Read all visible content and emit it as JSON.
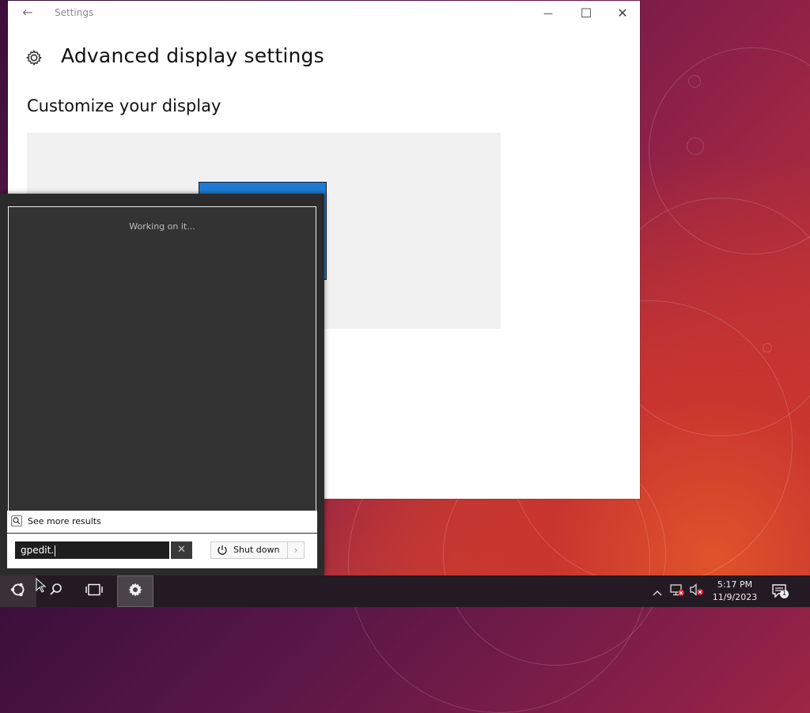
{
  "settings_window": {
    "app_title": "Settings",
    "page_title": "Advanced display settings",
    "section_title": "Customize your display",
    "minimize_glyph": "—",
    "maximize_glyph": "☐",
    "close_glyph": "✕"
  },
  "start_menu": {
    "status_text": "Working on it...",
    "see_more_label": "See more results",
    "search_value": "gpedit.",
    "clear_glyph": "✕",
    "shutdown_label": "Shut down",
    "shutdown_arrow": "›"
  },
  "taskbar": {
    "time": "5:17 PM",
    "date": "11/9/2023",
    "notification_count": "1"
  },
  "colors": {
    "accent": "#1f7ad3",
    "start_menu_bg": "#2b2b2b",
    "taskbar_bg": "#241a23"
  },
  "icons": [
    "back-arrow-icon",
    "gear-icon",
    "search-icon",
    "power-icon",
    "ubuntu-start-icon",
    "task-view-icon",
    "network-icon",
    "volume-muted-icon",
    "chevron-up-icon",
    "notification-icon"
  ]
}
